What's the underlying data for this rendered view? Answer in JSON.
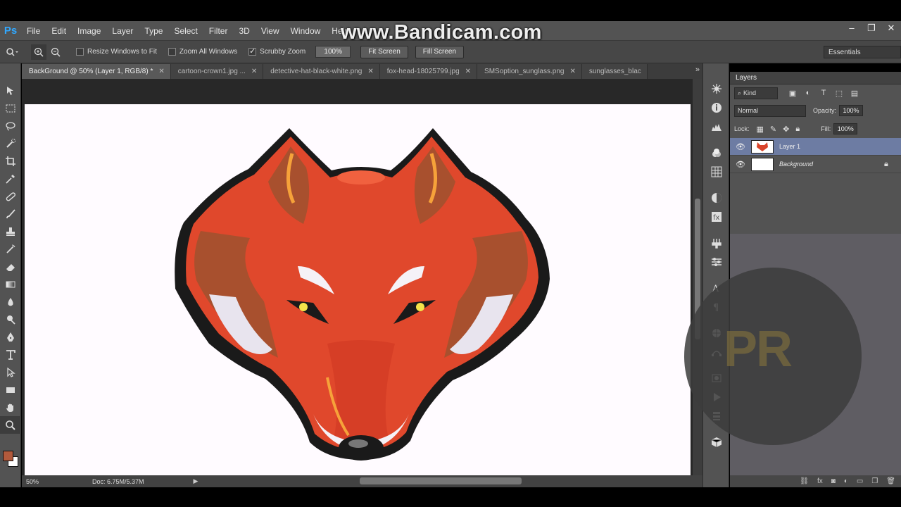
{
  "app": {
    "logo": "Ps",
    "watermark": "www.Bandicam.com"
  },
  "menu": [
    "File",
    "Edit",
    "Image",
    "Layer",
    "Type",
    "Select",
    "Filter",
    "3D",
    "View",
    "Window",
    "Help"
  ],
  "window_controls": {
    "minimize": "–",
    "maximize": "❐",
    "close": "✕"
  },
  "options": {
    "resize_windows": {
      "label": "Resize Windows to Fit",
      "checked": false
    },
    "zoom_all": {
      "label": "Zoom All Windows",
      "checked": false
    },
    "scrubby_zoom": {
      "label": "Scrubby Zoom",
      "checked": true
    },
    "zoom_value": "100%",
    "fit_screen": "Fit Screen",
    "fill_screen": "Fill Screen",
    "workspace": "Essentials"
  },
  "tabs": [
    {
      "label": "BackGround @ 50% (Layer 1, RGB/8) *",
      "active": true
    },
    {
      "label": "cartoon-crown1.jpg ...",
      "active": false
    },
    {
      "label": "detective-hat-black-white.png",
      "active": false
    },
    {
      "label": "fox-head-18025799.jpg",
      "active": false
    },
    {
      "label": "SMSoption_sunglass.png",
      "active": false
    },
    {
      "label": "sunglasses_blac",
      "active": false
    }
  ],
  "tabs_more": "»",
  "status": {
    "zoom": "50%",
    "doc": "Doc: 6.75M/5.37M"
  },
  "layers": {
    "title": "Layers",
    "kind": "Kind",
    "blend_mode": "Normal",
    "opacity_label": "Opacity:",
    "opacity": "100%",
    "lock_label": "Lock:",
    "fill_label": "Fill:",
    "fill": "100%",
    "items": [
      {
        "name": "Layer 1",
        "selected": true
      },
      {
        "name": "Background",
        "selected": false
      }
    ]
  },
  "overlay": {
    "text": "PR"
  },
  "colors": {
    "foreground": "#b25a3c",
    "background": "#ffffff",
    "accent": "#6d7ca3"
  }
}
